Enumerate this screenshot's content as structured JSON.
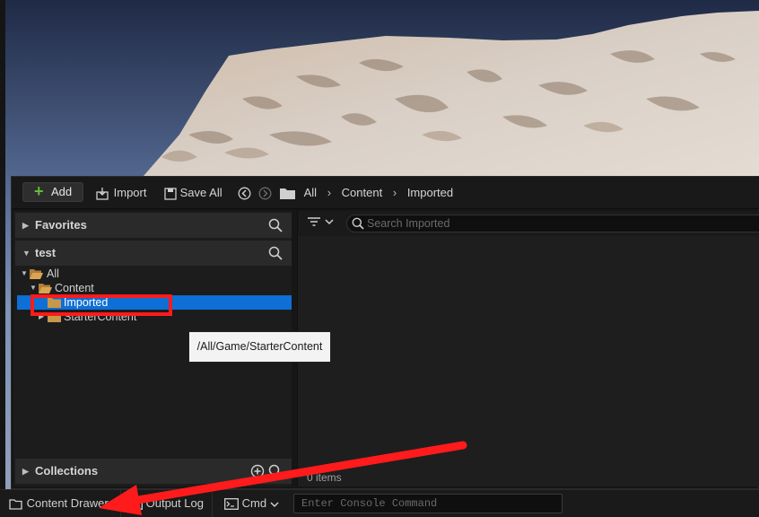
{
  "toolbar": {
    "add_label": "Add",
    "import_label": "Import",
    "save_all_label": "Save All",
    "breadcrumb": [
      "All",
      "Content",
      "Imported"
    ]
  },
  "left_panel": {
    "favorites_label": "Favorites",
    "project_label": "test",
    "collections_label": "Collections",
    "tree": [
      {
        "label": "All",
        "depth": 0,
        "expanded": true
      },
      {
        "label": "Content",
        "depth": 1,
        "expanded": true
      },
      {
        "label": "Imported",
        "depth": 2,
        "selected": true
      },
      {
        "label": "StarterContent",
        "depth": 2,
        "expanded": false
      }
    ]
  },
  "right_panel": {
    "search_placeholder": "Search Imported",
    "items_count": "0 items"
  },
  "tooltip": {
    "text": "/All/Game/StarterContent"
  },
  "statusbar": {
    "content_drawer_label": "Content Drawer",
    "output_log_label": "Output Log",
    "cmd_label": "Cmd",
    "console_placeholder": "Enter Console Command"
  },
  "colors": {
    "selection": "#0e6fd6",
    "annotation_red": "#ff1b1b",
    "add_green": "#5fbf3c",
    "folder": "#c8984a"
  },
  "icons": [
    "plus-icon",
    "import-icon",
    "save-icon",
    "back-icon",
    "forward-icon",
    "folder-icon",
    "chevron-right-icon",
    "search-icon",
    "filter-icon",
    "chevron-down-icon",
    "add-circle-icon",
    "content-drawer-icon",
    "output-log-icon",
    "cmd-icon"
  ]
}
